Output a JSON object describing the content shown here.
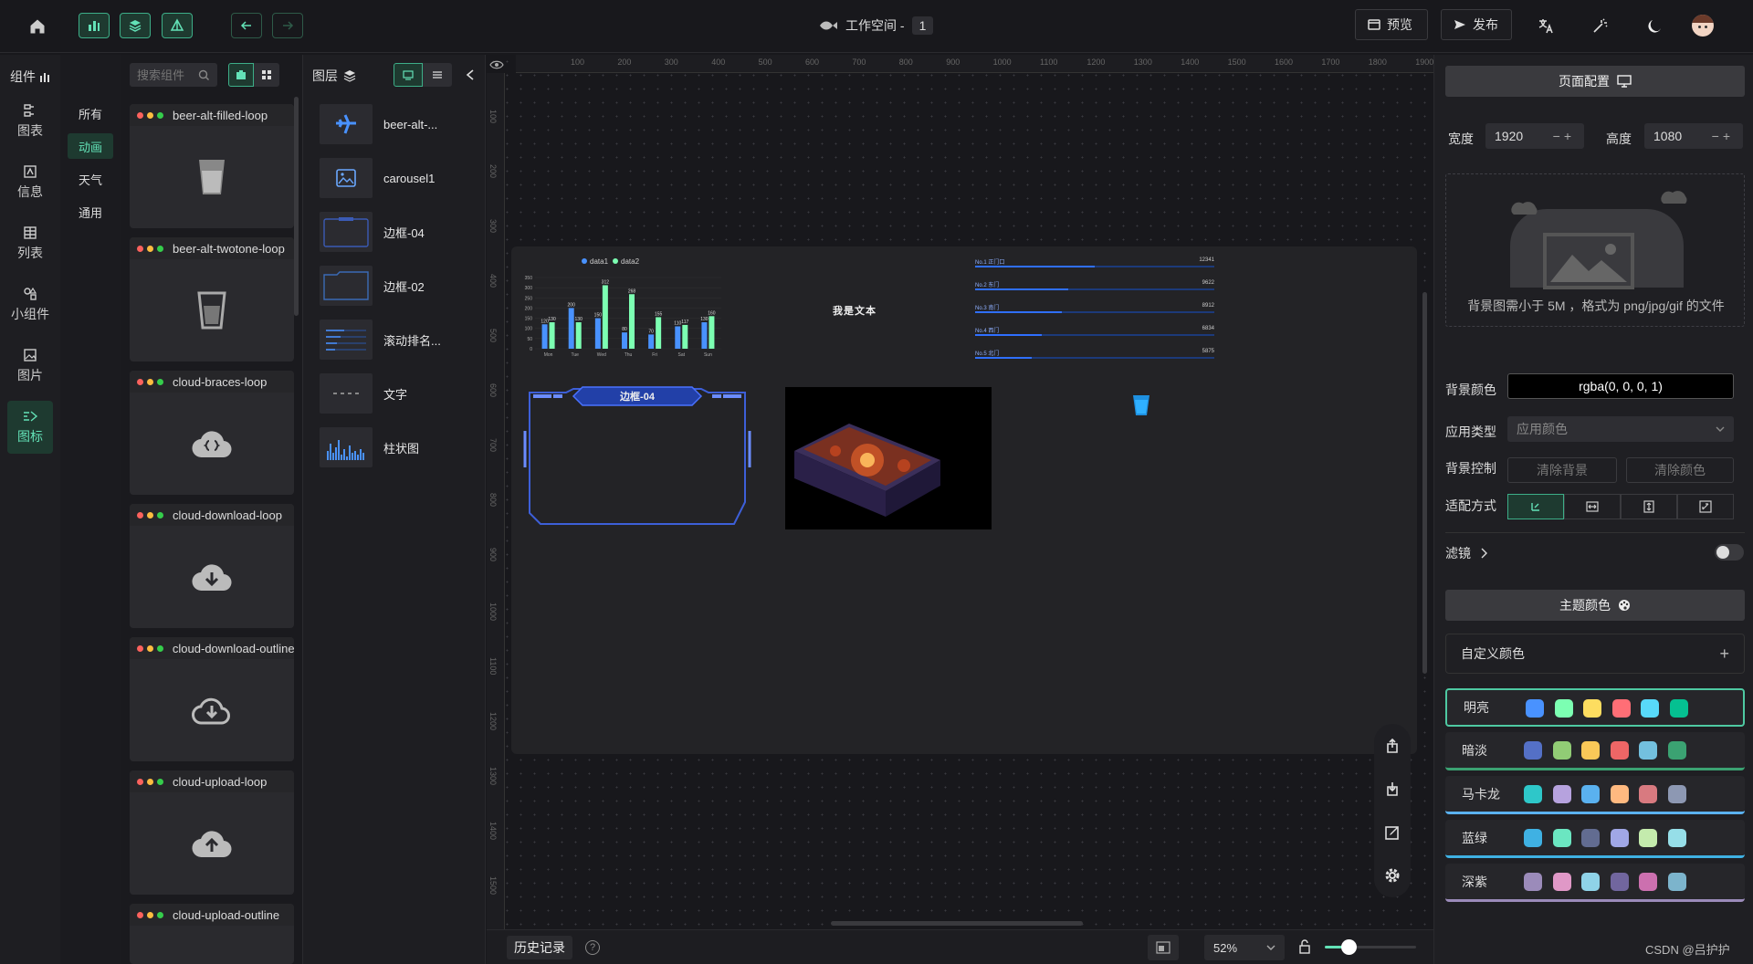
{
  "header": {
    "workspace_label": "工作空间 -",
    "workspace_num": "1",
    "preview_label": "预览",
    "publish_label": "发布"
  },
  "nav": {
    "items": [
      {
        "label": "图表",
        "icon": "chart-icon"
      },
      {
        "label": "信息",
        "icon": "info-icon"
      },
      {
        "label": "列表",
        "icon": "table-icon"
      },
      {
        "label": "小组件",
        "icon": "widget-icon"
      },
      {
        "label": "图片",
        "icon": "image-icon"
      },
      {
        "label": "图标",
        "icon": "icon-icon"
      }
    ],
    "active": 5
  },
  "panel": {
    "title": "组件",
    "search_placeholder": "搜索组件"
  },
  "subnav": {
    "items": [
      "所有",
      "动画",
      "天气",
      "通用"
    ],
    "active": 1
  },
  "components": [
    {
      "title": "beer-alt-filled-loop",
      "icon": "cup-filled-icon"
    },
    {
      "title": "beer-alt-twotone-loop",
      "icon": "cup-twotone-icon"
    },
    {
      "title": "cloud-braces-loop",
      "icon": "cloud-braces-icon"
    },
    {
      "title": "cloud-download-loop",
      "icon": "cloud-download-icon"
    },
    {
      "title": "cloud-download-outline",
      "icon": "cloud-download-outline-icon"
    },
    {
      "title": "cloud-upload-loop",
      "icon": "cloud-upload-icon"
    },
    {
      "title": "cloud-upload-outline",
      "icon": "cloud-upload-outline-icon"
    }
  ],
  "layers": {
    "title": "图层",
    "items": [
      {
        "name": "beer-alt-...",
        "icon": "airplane-icon"
      },
      {
        "name": "carousel1",
        "icon": "image-icon"
      },
      {
        "name": "边框-04",
        "icon": "border-icon"
      },
      {
        "name": "边框-02",
        "icon": "border-icon"
      },
      {
        "name": "滚动排名...",
        "icon": "list-icon"
      },
      {
        "name": "文字",
        "icon": "text-icon"
      },
      {
        "name": "柱状图",
        "icon": "bar-chart-icon"
      }
    ]
  },
  "ruler": {
    "top": [
      "100",
      "200",
      "300",
      "400",
      "500",
      "600",
      "700",
      "800",
      "900",
      "1000",
      "1100",
      "1200",
      "1300",
      "1400",
      "1500",
      "1600",
      "1700",
      "1800",
      "1900"
    ],
    "left": [
      "100",
      "200",
      "300",
      "400",
      "500",
      "600",
      "700",
      "800",
      "900",
      "1000",
      "1100",
      "1200",
      "1300",
      "1400",
      "1500"
    ]
  },
  "canvas": {
    "text_widget": "我是文本",
    "border_title": "边框-04",
    "ranking": [
      {
        "label": "No.1 正门口",
        "value": "12341"
      },
      {
        "label": "No.2 东门",
        "value": "9622"
      },
      {
        "label": "No.3 南门",
        "value": "8912"
      },
      {
        "label": "No.4 西门",
        "value": "6834"
      },
      {
        "label": "No.5 北门",
        "value": "5875"
      }
    ]
  },
  "chart_data": {
    "type": "bar",
    "categories": [
      "Mon",
      "Tue",
      "Wed",
      "Thu",
      "Fri",
      "Sat",
      "Sun"
    ],
    "series": [
      {
        "name": "data1",
        "values": [
          120,
          200,
          150,
          80,
          70,
          110,
          130
        ]
      },
      {
        "name": "data2",
        "values": [
          130,
          130,
          312,
          268,
          155,
          117,
          160
        ]
      }
    ],
    "ylim": [
      0,
      350
    ],
    "yticks": [
      "0",
      "50",
      "100",
      "150",
      "200",
      "250",
      "300",
      "350"
    ],
    "colors": [
      "#4992ff",
      "#7cffb2"
    ],
    "legend": "top"
  },
  "bottom": {
    "history_label": "历史记录",
    "zoom_value": "52%"
  },
  "right": {
    "page_config_title": "页面配置",
    "width_label": "宽度",
    "width_value": "1920",
    "height_label": "高度",
    "height_value": "1080",
    "bg_hint": "背景图需小于 5M ，格式为 png/jpg/gif 的文件",
    "bg_color_label": "背景颜色",
    "bg_color_value": "rgba(0, 0, 0, 1)",
    "app_type_label": "应用类型",
    "app_type_value": "应用颜色",
    "bg_control_label": "背景控制",
    "clear_bg_label": "清除背景",
    "clear_color_label": "清除颜色",
    "fit_label": "适配方式",
    "filter_label": "滤镜",
    "theme_title": "主题颜色",
    "custom_color_label": "自定义颜色",
    "themes": [
      {
        "name": "明亮",
        "colors": [
          "#4992ff",
          "#7cffb2",
          "#fddd60",
          "#ff6e76",
          "#58d9f9",
          "#05c091"
        ],
        "accent": "#4ec9a2"
      },
      {
        "name": "暗淡",
        "colors": [
          "#5470c6",
          "#91cc75",
          "#fac858",
          "#ee6666",
          "#73c0de",
          "#3ba272"
        ],
        "accent": "#3ba272"
      },
      {
        "name": "马卡龙",
        "colors": [
          "#2ec7c9",
          "#b6a2de",
          "#5ab1ef",
          "#ffb980",
          "#d87a80",
          "#8d98b3"
        ],
        "accent": "#5ab1ef"
      },
      {
        "name": "蓝绿",
        "colors": [
          "#3fb1e3",
          "#6be6c1",
          "#626c91",
          "#a0a7e6",
          "#c4ebad",
          "#96dee8"
        ],
        "accent": "#3fb1e3"
      },
      {
        "name": "深紫",
        "colors": [
          "#9b8bba",
          "#e098c7",
          "#8fd3e8",
          "#71669e",
          "#cc70af",
          "#7cb4cc"
        ],
        "accent": "#9b8bba"
      }
    ]
  },
  "watermark": "CSDN @吕护护"
}
